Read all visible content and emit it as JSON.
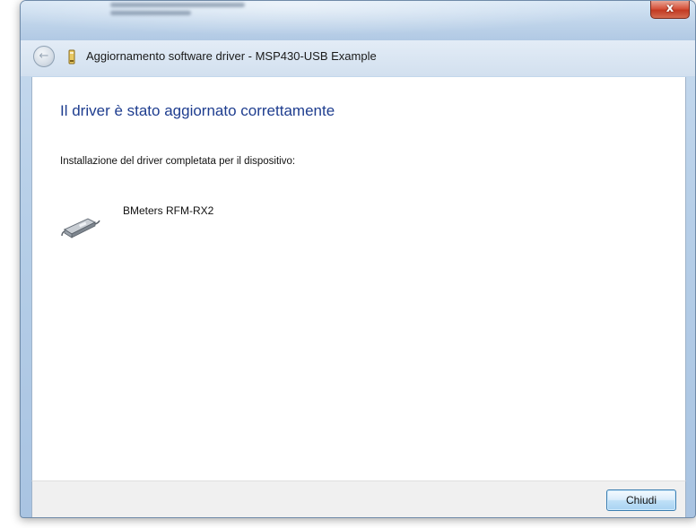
{
  "window": {
    "title": "Aggiornamento software driver - MSP430-USB Example",
    "close_glyph": "x"
  },
  "header": {
    "back_icon": "back-arrow-icon",
    "back_glyph": "←"
  },
  "main": {
    "heading": "Il driver è stato aggiornato correttamente",
    "subtitle": "Installazione del driver completata per il dispositivo:",
    "device": {
      "icon": "usb-device-icon",
      "name": "BMeters RFM-RX2"
    }
  },
  "footer": {
    "close_label": "Chiudi"
  },
  "colors": {
    "heading": "#1e3d8f",
    "close_button": "#c23a22"
  }
}
